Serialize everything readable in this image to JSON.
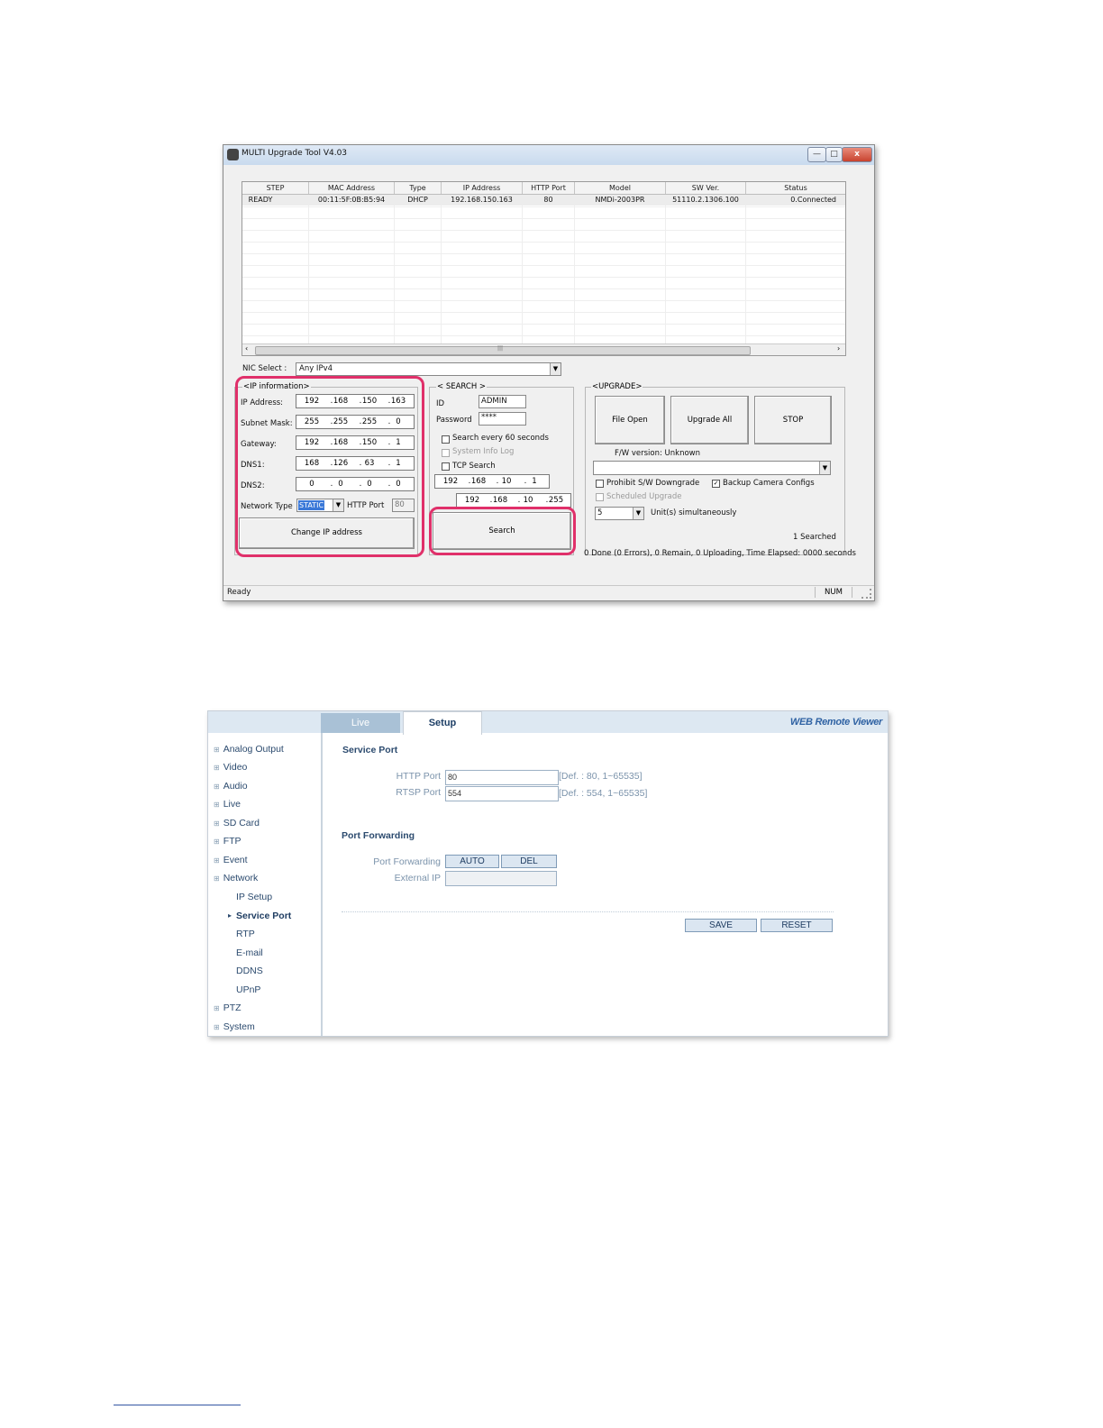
{
  "app": {
    "title": "MULTI Upgrade Tool V4.03",
    "window_buttons": {
      "minimize": "—",
      "maximize": "□",
      "close": "x"
    },
    "device_list": {
      "columns": [
        "STEP",
        "MAC Address",
        "Type",
        "IP Address",
        "HTTP Port",
        "Model",
        "SW Ver.",
        "Status"
      ],
      "rows": [
        [
          "READY",
          "00:11:5F:0B:B5:94",
          "DHCP",
          "192.168.150.163",
          "80",
          "NMDi-2003PR",
          "51110.2.1306.100",
          "0.Connected"
        ]
      ],
      "scroll_left": "‹",
      "scroll_right": "›",
      "scroll_grip": "|||"
    },
    "nic": {
      "label": "NIC Select :",
      "value": "Any IPv4"
    },
    "ip_info": {
      "title": "<IP information>",
      "ip_label": "IP Address:",
      "ip": [
        "192",
        "168",
        "150",
        "163"
      ],
      "subnet_label": "Subnet Mask:",
      "subnet": [
        "255",
        "255",
        "255",
        "0"
      ],
      "gateway_label": "Gateway:",
      "gateway": [
        "192",
        "168",
        "150",
        "1"
      ],
      "dns1_label": "DNS1:",
      "dns1": [
        "168",
        "126",
        "63",
        "1"
      ],
      "dns2_label": "DNS2:",
      "dns2": [
        "0",
        "0",
        "0",
        "0"
      ],
      "network_type_label": "Network Type",
      "network_type": "STATIC",
      "http_port_label": "HTTP Port",
      "http_port": "80",
      "change_button": "Change IP address"
    },
    "search": {
      "title": "< SEARCH >",
      "id_label": "ID",
      "id_value": "ADMIN",
      "password_label": "Password",
      "password_value": "****",
      "search_every": "Search every 60 seconds",
      "system_info_log": "System Info Log",
      "tcp_search": "TCP Search",
      "tcp_from": [
        "192",
        "168",
        "10",
        "1"
      ],
      "tcp_to": [
        "192",
        "168",
        "10",
        "255"
      ],
      "search_button": "Search"
    },
    "upgrade": {
      "title": "<UPGRADE>",
      "file_open": "File Open",
      "upgrade_all": "Upgrade All",
      "stop": "STOP",
      "fw_version": "F/W version: Unknown",
      "prohibit_downgrade": "Prohibit S/W Downgrade",
      "backup_configs": "Backup Camera Configs",
      "backup_checked": "✓",
      "scheduled_upgrade": "Scheduled Upgrade",
      "units_value": "5",
      "units_label": "Unit(s) simultaneously",
      "searched": "1 Searched"
    },
    "progress": "0 Done (0 Errors), 0 Remain, 0 Uploading, Time Elapsed: 0000 seconds",
    "statusbar": {
      "text": "Ready",
      "num": "NUM"
    }
  },
  "web": {
    "tabs": [
      "Live",
      "Setup"
    ],
    "brand": "WEB Remote Viewer",
    "sidebar": {
      "items": [
        "Analog Output",
        "Video",
        "Audio",
        "Live",
        "SD Card",
        "FTP",
        "Event",
        "Network"
      ],
      "network_sub": [
        "IP Setup",
        "Service Port",
        "RTP",
        "E-mail",
        "DDNS",
        "UPnP"
      ],
      "tail_items": [
        "PTZ",
        "System"
      ],
      "plus": "⊞",
      "active_marker": "▸"
    },
    "service_port": {
      "heading": "Service Port",
      "http_label": "HTTP Port",
      "http_value": "80",
      "http_hint": "[Def. : 80, 1~65535]",
      "rtsp_label": "RTSP Port",
      "rtsp_value": "554",
      "rtsp_hint": "[Def. : 554, 1~65535]"
    },
    "port_forwarding": {
      "heading": "Port Forwarding",
      "label": "Port Forwarding",
      "auto": "AUTO",
      "del": "DEL",
      "external_ip_label": "External IP",
      "external_ip": ""
    },
    "actions": {
      "save": "SAVE",
      "reset": "RESET"
    }
  }
}
